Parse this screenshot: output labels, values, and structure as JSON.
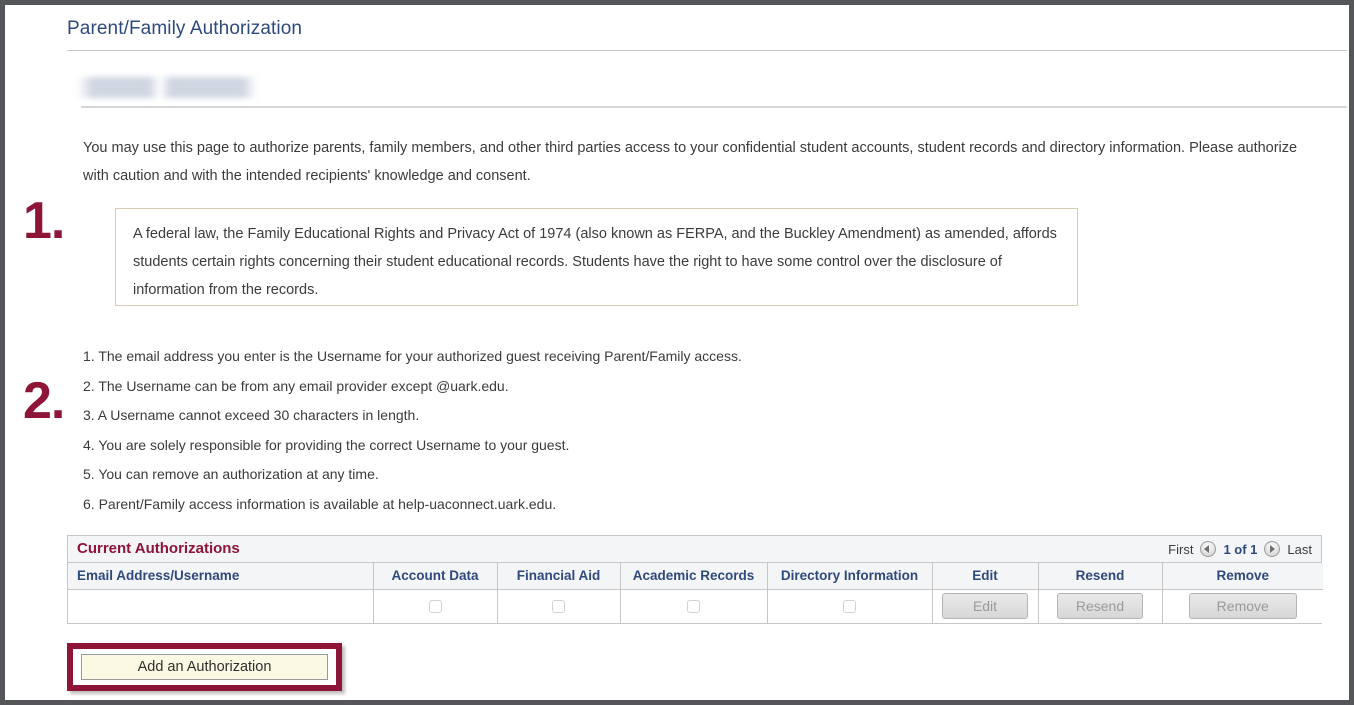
{
  "page": {
    "title": "Parent/Family Authorization",
    "student_name_redacted": ""
  },
  "intro": {
    "paragraph": "You may use this page to authorize parents, family members, and other third parties access to your confidential student accounts, student records and directory information. Please authorize with caution and with the intended recipients' knowledge and consent."
  },
  "ferpa_box": {
    "text": "A federal law, the Family Educational Rights and Privacy Act of 1974 (also known as FERPA, and the Buckley Amendment) as amended, affords students certain rights concerning their student educational records. Students have the right to have some control over the disclosure of information from the records."
  },
  "callouts": [
    {
      "label": "1."
    },
    {
      "label": "2."
    }
  ],
  "rules": [
    "1. The email address you enter is the Username for your authorized guest receiving Parent/Family access.",
    "2. The Username can be from any email provider except @uark.edu.",
    "3. A Username cannot exceed 30 characters in length.",
    "4. You are solely responsible for providing the correct Username to your guest.",
    "5. You can remove an authorization at any time.",
    "6. Parent/Family access information is available at help-uaconnect.uark.edu."
  ],
  "grid": {
    "caption": "Current Authorizations",
    "pager": {
      "first_label": "First",
      "count_label": "1 of 1",
      "last_label": "Last",
      "prev_icon": "prev-arrow-icon",
      "next_icon": "next-arrow-icon"
    },
    "columns": [
      "Email Address/Username",
      "Account Data",
      "Financial Aid",
      "Academic Records",
      "Directory Information",
      "Edit",
      "Resend",
      "Remove"
    ],
    "row": {
      "email": "",
      "account_data_checked": false,
      "financial_aid_checked": false,
      "academic_records_checked": false,
      "directory_information_checked": false,
      "edit_label": "Edit",
      "resend_label": "Resend",
      "remove_label": "Remove"
    }
  },
  "footer": {
    "add_button_label": "Add an Authorization"
  },
  "colors": {
    "title_blue": "#2e4a7d",
    "accent_maroon": "#8e1438",
    "grid_header_bg": "#f4f5f7",
    "ferpa_border": "#d9cdb4",
    "add_button_bg": "#fbf8e3"
  }
}
